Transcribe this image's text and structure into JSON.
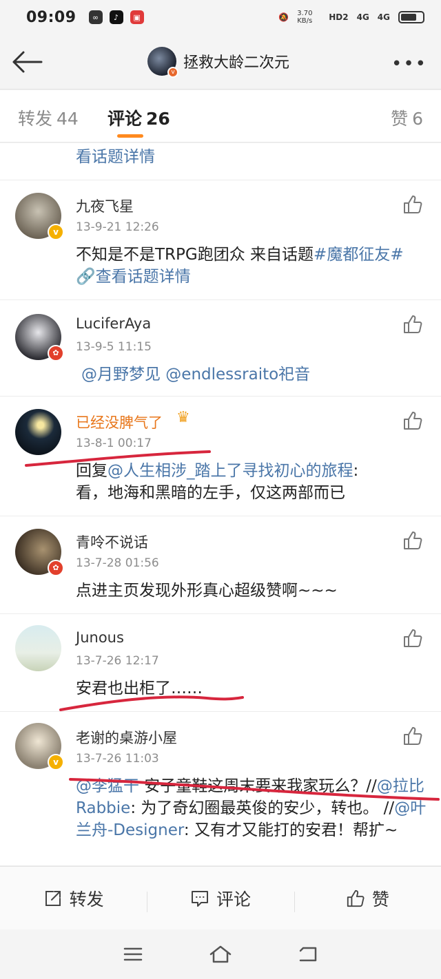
{
  "status_bar": {
    "time": "09:09",
    "net_speed": "3.70 KB/s",
    "hd": "HD2",
    "signal1": "4G",
    "signal2": "4G"
  },
  "header": {
    "title": "拯救大龄二次元"
  },
  "tabs": [
    {
      "label": "转发",
      "count": "44"
    },
    {
      "label": "评论",
      "count": "26"
    },
    {
      "label": "赞",
      "count": "6"
    }
  ],
  "partial_top": {
    "text": "看话题详情"
  },
  "comments": [
    {
      "name": "九夜飞星",
      "time": "13-9-21 12:26",
      "text_plain": "不知是不是TRPG跑团众 来自话题",
      "text_link": "#魔都征友#",
      "text_link2": "查看话题详情",
      "badge": "v"
    },
    {
      "name": "LuciferAya",
      "time": "13-9-5 11:15",
      "text_link": "@月野梦见 @endlessraito祀音",
      "badge": "r"
    },
    {
      "name": "已经没脾气了",
      "time": "13-8-1 00:17",
      "text_plain1": "回复",
      "text_link": "@人生相涉_踏上了寻找初心的旅程",
      "text_plain2": ":",
      "text_plain3": "看，地海和黑暗的左手，仅这两部而已",
      "crown": "♛"
    },
    {
      "name": "青呤不说话",
      "time": "13-7-28 01:56",
      "text_plain": "点进主页发现外形真心超级赞啊~~~",
      "badge": "r"
    },
    {
      "name": "Junous",
      "time": "13-7-26 12:17",
      "text_plain": "安君也出柜了……"
    },
    {
      "name": "老谢的桌游小屋",
      "time": "13-7-26 11:03",
      "text_link1": "@李猛干",
      "text_plain1": " 安子童鞋这周末要来我家玩么？//",
      "text_link2": "@拉比Rabbie",
      "text_plain2": ": 为了奇幻圈最英俊的安少，转也。 //",
      "text_link3": "@叶兰舟-Designer",
      "text_plain3": ": 又有才又能打的安君！帮扩~",
      "badge": "v"
    }
  ],
  "action_bar": {
    "repost": "转发",
    "comment": "评论",
    "like": "赞"
  },
  "colors": {
    "link": "#4a76a8",
    "accent": "#ff8a1f",
    "annotation": "#d7263d"
  }
}
